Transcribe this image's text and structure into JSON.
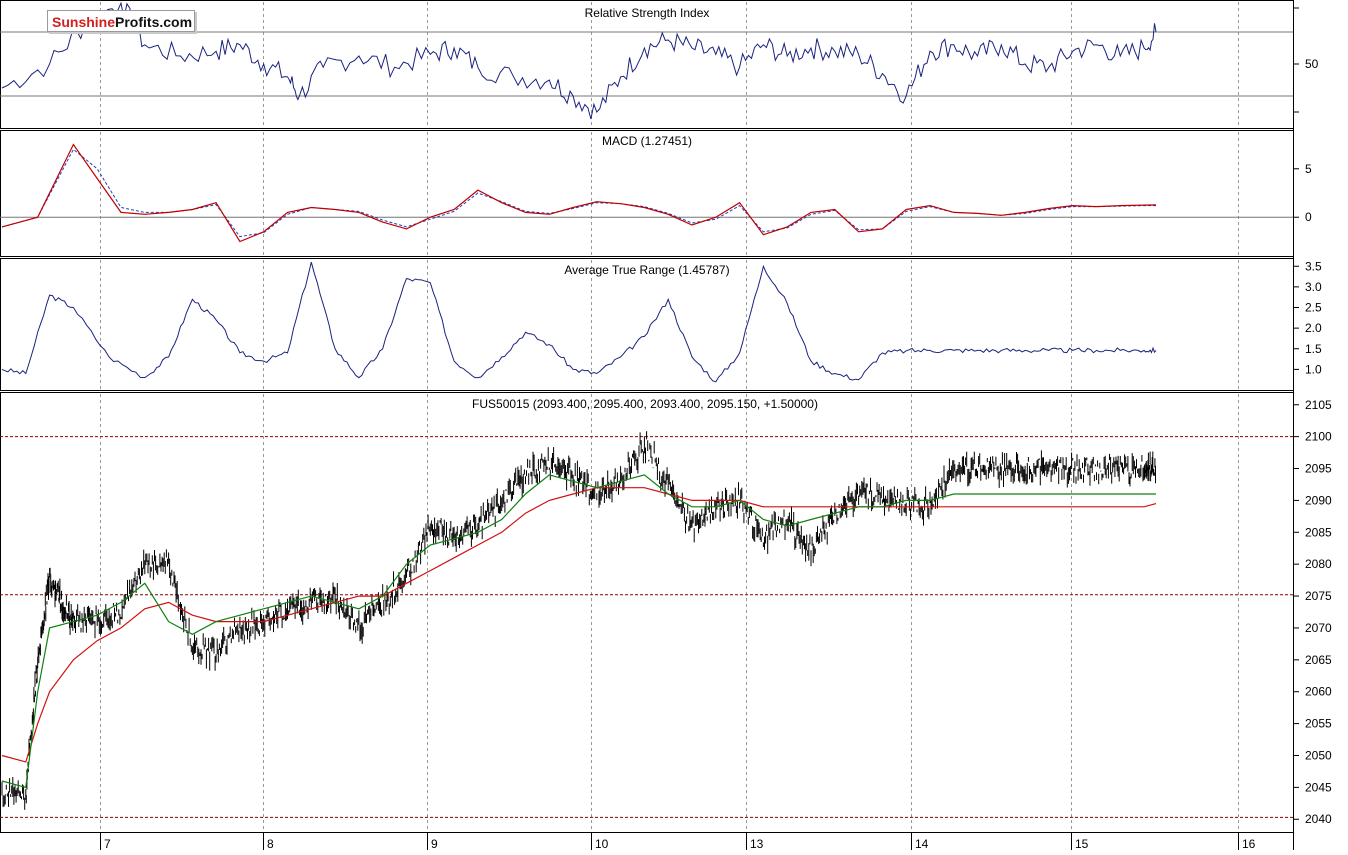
{
  "brand": {
    "part1": "Sunshine",
    "part2": "Profits.com"
  },
  "x_axis": {
    "labels": [
      "7",
      "8",
      "9",
      "10",
      "13",
      "14",
      "15",
      "16"
    ]
  },
  "panels": {
    "rsi": {
      "title": "Relative Strength Index",
      "tick_labels": [
        "50"
      ]
    },
    "macd": {
      "title": "MACD (1.27451)",
      "tick_labels": [
        "5",
        "0"
      ]
    },
    "atr": {
      "title": "Average True Range (1.45787)",
      "tick_labels": [
        "3.5",
        "3.0",
        "2.5",
        "2.0",
        "1.5",
        "1.0"
      ]
    },
    "price": {
      "title": "FUS50015 (2093.400, 2095.400, 2093.400, 2095.150, +1.50000)",
      "tick_labels": [
        "2105",
        "2100",
        "2095",
        "2090",
        "2085",
        "2080",
        "2075",
        "2070",
        "2065",
        "2060",
        "2055",
        "2050",
        "2045",
        "2040"
      ]
    }
  },
  "colors": {
    "rsi_line": "#1a237e",
    "macd_line": "#c00000",
    "macd_signal": "#1f3fbf",
    "atr_line": "#1a237e",
    "ma_fast": "#108010",
    "ma_slow": "#d01010",
    "price_bars": "#000000",
    "ref_lines": "#8b0000"
  },
  "chart_data": [
    {
      "type": "line",
      "title": "Relative Strength Index",
      "ylim": [
        10,
        90
      ],
      "reference_lines": [
        70,
        30
      ],
      "series": [
        {
          "x": [
            0,
            4,
            7,
            10,
            12,
            15,
            18,
            20,
            22,
            24,
            25,
            27,
            30,
            33,
            36,
            38,
            40,
            43,
            46,
            48,
            50,
            52,
            54,
            56,
            58,
            60,
            62,
            64,
            66,
            68,
            70,
            72,
            74,
            76,
            78,
            80,
            82,
            84,
            86,
            88,
            90,
            92,
            94,
            96,
            97
          ],
          "values": [
            35,
            50,
            75,
            88,
            62,
            55,
            58,
            62,
            50,
            42,
            30,
            48,
            55,
            48,
            56,
            60,
            48,
            42,
            40,
            30,
            20,
            42,
            60,
            65,
            60,
            56,
            48,
            62,
            55,
            60,
            58,
            56,
            44,
            30,
            58,
            62,
            55,
            62,
            50,
            48,
            58,
            62,
            55,
            60,
            70
          ]
        }
      ]
    },
    {
      "type": "line",
      "title": "MACD (1.27451)",
      "ylim": [
        -4,
        9
      ],
      "series": [
        {
          "name": "MACD",
          "x": [
            0,
            3,
            6,
            8,
            10,
            12,
            14,
            16,
            18,
            20,
            22,
            24,
            26,
            28,
            30,
            32,
            34,
            36,
            38,
            40,
            42,
            44,
            46,
            48,
            50,
            52,
            54,
            56,
            58,
            60,
            62,
            64,
            66,
            68,
            70,
            72,
            74,
            76,
            78,
            80,
            82,
            84,
            86,
            88,
            90,
            92,
            94,
            96,
            97
          ],
          "values": [
            -1,
            0,
            7.5,
            4,
            0.5,
            0.3,
            0.5,
            0.8,
            1.5,
            -2.5,
            -1.5,
            0.5,
            1,
            0.8,
            0.5,
            -0.5,
            -1.2,
            0,
            0.8,
            2.8,
            1.5,
            0.5,
            0.3,
            1,
            1.6,
            1.4,
            1,
            0.3,
            -0.8,
            0,
            1.5,
            -1.8,
            -1,
            0.5,
            0.8,
            -1.5,
            -1.2,
            0.8,
            1.2,
            0.5,
            0.4,
            0.2,
            0.5,
            0.9,
            1.2,
            1.1,
            1.2,
            1.25,
            1.27
          ]
        },
        {
          "name": "Signal",
          "x": [
            0,
            3,
            6,
            8,
            10,
            12,
            14,
            16,
            18,
            20,
            22,
            24,
            26,
            28,
            30,
            32,
            34,
            36,
            38,
            40,
            42,
            44,
            46,
            48,
            50,
            52,
            54,
            56,
            58,
            60,
            62,
            64,
            66,
            68,
            70,
            72,
            74,
            76,
            78,
            80,
            82,
            84,
            86,
            88,
            90,
            92,
            94,
            96,
            97
          ],
          "values": [
            -1,
            0,
            7,
            5,
            1,
            0.5,
            0.5,
            0.8,
            1.3,
            -2,
            -1.6,
            0.3,
            1,
            0.8,
            0.6,
            -0.3,
            -1,
            -0.2,
            0.6,
            2.5,
            1.6,
            0.6,
            0.4,
            0.9,
            1.5,
            1.4,
            1.1,
            0.4,
            -0.6,
            -0.2,
            1.2,
            -1.5,
            -1.1,
            0.3,
            0.7,
            -1.3,
            -1.2,
            0.6,
            1.1,
            0.5,
            0.4,
            0.2,
            0.4,
            0.8,
            1.1,
            1.1,
            1.15,
            1.2,
            1.2
          ]
        }
      ]
    },
    {
      "type": "line",
      "title": "Average True Range (1.45787)",
      "ylim": [
        0.5,
        3.7
      ],
      "series": [
        {
          "x": [
            0,
            2,
            4,
            6,
            9,
            12,
            14,
            16,
            18,
            20,
            22,
            24,
            26,
            28,
            30,
            32,
            34,
            36,
            38,
            40,
            42,
            44,
            46,
            48,
            50,
            52,
            54,
            56,
            58,
            60,
            62,
            64,
            66,
            68,
            70,
            72,
            74,
            76,
            78,
            80,
            82,
            84,
            86,
            88,
            90,
            92,
            94,
            96,
            97
          ],
          "values": [
            1,
            0.9,
            2.8,
            2.5,
            1.3,
            0.8,
            1.3,
            2.7,
            2.2,
            1.4,
            1.2,
            1.4,
            3.6,
            1.5,
            0.8,
            1.5,
            3.2,
            3.1,
            1.2,
            0.8,
            1.3,
            1.9,
            1.6,
            1,
            0.9,
            1.3,
            1.8,
            2.7,
            1.3,
            0.7,
            1.4,
            3.5,
            2.6,
            1.2,
            0.9,
            0.75,
            1.4,
            1.45,
            1.46,
            1.46,
            1.46,
            1.46,
            1.46,
            1.46,
            1.46,
            1.46,
            1.46,
            1.46,
            1.46
          ]
        }
      ]
    },
    {
      "type": "line",
      "title": "FUS50015 (2093.400, 2095.400, 2093.400, 2095.150, +1.50000)",
      "ylim": [
        2038,
        2107
      ],
      "reference_lines": [
        2100,
        2075.2,
        2040.3
      ],
      "categories": [
        "7",
        "8",
        "9",
        "10",
        "13",
        "14",
        "15",
        "16"
      ],
      "series": [
        {
          "name": "Price",
          "x": [
            0,
            2,
            3,
            4,
            5,
            6,
            8,
            10,
            12,
            14,
            16,
            18,
            20,
            22,
            24,
            26,
            28,
            30,
            32,
            34,
            36,
            38,
            40,
            42,
            44,
            46,
            48,
            50,
            52,
            54,
            56,
            58,
            60,
            62,
            64,
            66,
            68,
            70,
            72,
            74,
            76,
            78,
            80,
            82,
            84,
            86,
            88,
            90,
            92,
            94,
            96,
            97
          ],
          "values": [
            2044,
            2044,
            2065,
            2078,
            2074,
            2071,
            2071,
            2073,
            2080,
            2080,
            2067,
            2066,
            2070,
            2071,
            2073,
            2074,
            2075,
            2070,
            2074,
            2078,
            2086,
            2084,
            2086,
            2090,
            2094,
            2096,
            2094,
            2091,
            2093,
            2099,
            2092,
            2086,
            2089,
            2090,
            2084,
            2087,
            2082,
            2088,
            2091,
            2090,
            2090,
            2089,
            2095,
            2095,
            2095,
            2095,
            2095,
            2095,
            2095,
            2095,
            2095,
            2095.15
          ]
        },
        {
          "name": "Fast MA",
          "x": [
            0,
            2,
            3,
            4,
            6,
            8,
            10,
            12,
            14,
            16,
            18,
            20,
            22,
            24,
            26,
            28,
            30,
            32,
            34,
            36,
            38,
            40,
            42,
            44,
            46,
            48,
            50,
            52,
            54,
            56,
            58,
            60,
            62,
            64,
            66,
            68,
            70,
            72,
            74,
            76,
            78,
            80,
            82,
            84,
            86,
            88,
            90,
            92,
            94,
            96,
            97
          ],
          "values": [
            2046,
            2045,
            2060,
            2070,
            2071,
            2072,
            2074,
            2077,
            2071,
            2069,
            2071,
            2072,
            2073,
            2074,
            2075,
            2074,
            2073,
            2075,
            2080,
            2083,
            2084,
            2085,
            2087,
            2091,
            2094,
            2093,
            2092,
            2093,
            2094,
            2091,
            2089,
            2089,
            2090,
            2087,
            2086,
            2087,
            2088,
            2089,
            2089,
            2090,
            2090,
            2091,
            2091,
            2091,
            2091,
            2091,
            2091,
            2091,
            2091,
            2091,
            2091
          ]
        },
        {
          "name": "Slow MA",
          "x": [
            0,
            2,
            3,
            4,
            6,
            8,
            10,
            12,
            14,
            16,
            18,
            20,
            22,
            24,
            26,
            28,
            30,
            32,
            34,
            36,
            38,
            40,
            42,
            44,
            46,
            48,
            50,
            52,
            54,
            56,
            58,
            60,
            62,
            64,
            66,
            68,
            70,
            72,
            74,
            76,
            78,
            80,
            82,
            84,
            86,
            88,
            90,
            92,
            94,
            96,
            97
          ],
          "values": [
            2050,
            2049,
            2055,
            2060,
            2065,
            2068,
            2070,
            2073,
            2074,
            2072,
            2071,
            2071,
            2071,
            2072,
            2073,
            2074,
            2075,
            2075,
            2077,
            2079,
            2081,
            2083,
            2085,
            2088,
            2090,
            2091,
            2092,
            2092,
            2092,
            2091,
            2090,
            2090,
            2090,
            2089,
            2089,
            2089,
            2089,
            2089,
            2089,
            2089,
            2089,
            2089,
            2089,
            2089,
            2089,
            2089,
            2089,
            2089,
            2089,
            2089,
            2089.5
          ]
        }
      ]
    }
  ]
}
